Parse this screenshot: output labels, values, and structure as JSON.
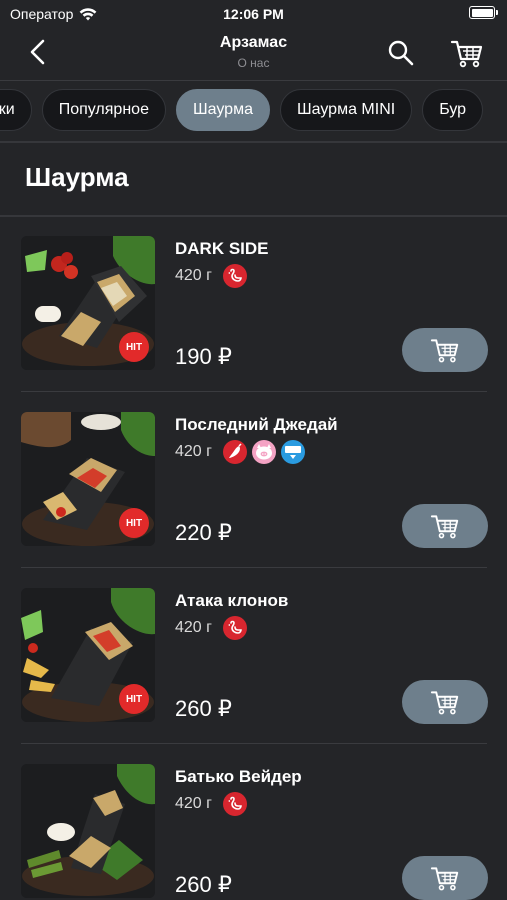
{
  "status_bar": {
    "carrier": "Оператор",
    "time": "12:06 PM"
  },
  "nav": {
    "title": "Арзамас",
    "subtitle": "О нас",
    "back_icon": "chevron-left-icon",
    "search_icon": "search-icon",
    "cart_icon": "cart-icon"
  },
  "categories": [
    {
      "label": "инки",
      "active": false
    },
    {
      "label": "Популярное",
      "active": false
    },
    {
      "label": "Шаурма",
      "active": true
    },
    {
      "label": "Шаурма MINI",
      "active": false
    },
    {
      "label": "Бур",
      "active": false
    }
  ],
  "section": {
    "title": "Шаурма"
  },
  "items": [
    {
      "name": "DARK SIDE",
      "weight": "420 г",
      "price": "190 ₽",
      "hit": "HIT",
      "tags": [
        "chicken"
      ]
    },
    {
      "name": "Последний Джедай",
      "weight": "420 г",
      "price": "220 ₽",
      "hit": "HIT",
      "tags": [
        "chili",
        "pork",
        "kcal"
      ]
    },
    {
      "name": "Атака клонов",
      "weight": "420 г",
      "price": "260 ₽",
      "hit": "HIT",
      "tags": [
        "chicken"
      ]
    },
    {
      "name": "Батько Вейдер",
      "weight": "420 г",
      "price": "260 ₽",
      "hit": "",
      "tags": [
        "chicken"
      ]
    }
  ],
  "colors": {
    "background": "#242528",
    "accent": "#6e7f8c",
    "tag_red": "#d8262f",
    "tag_pink": "#f4a3c4",
    "tag_blue": "#2a9be0"
  }
}
